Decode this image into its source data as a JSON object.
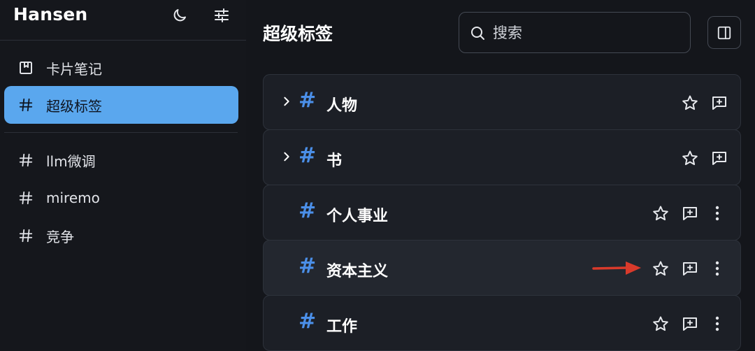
{
  "sidebar": {
    "brand": "Hansen",
    "icons": {
      "theme": "moon-icon",
      "settings": "sliders-icon"
    },
    "primary_items": [
      {
        "label": "卡片笔记",
        "icon": "card-note-icon"
      },
      {
        "label": "超级标签",
        "icon": "hash-icon",
        "active": true
      }
    ],
    "tag_items": [
      {
        "label": "llm微调",
        "icon": "hash-icon"
      },
      {
        "label": "miremo",
        "icon": "hash-icon"
      },
      {
        "label": "竞争",
        "icon": "hash-icon"
      }
    ]
  },
  "main": {
    "title": "超级标签",
    "search": {
      "placeholder": "搜索",
      "value": ""
    },
    "panel_toggle_icon": "sidebar-panel-icon",
    "tags": [
      {
        "label": "人物",
        "expandable": true
      },
      {
        "label": "书",
        "expandable": true
      },
      {
        "label": "个人事业",
        "expandable": false
      },
      {
        "label": "资本主义",
        "expandable": false,
        "hovered": true
      },
      {
        "label": "工作",
        "expandable": false
      }
    ]
  },
  "colors": {
    "background": "#14161b",
    "accent": "#5aa7ee",
    "hash": "#4b8fe8",
    "annotation_arrow": "#d93a2b"
  }
}
